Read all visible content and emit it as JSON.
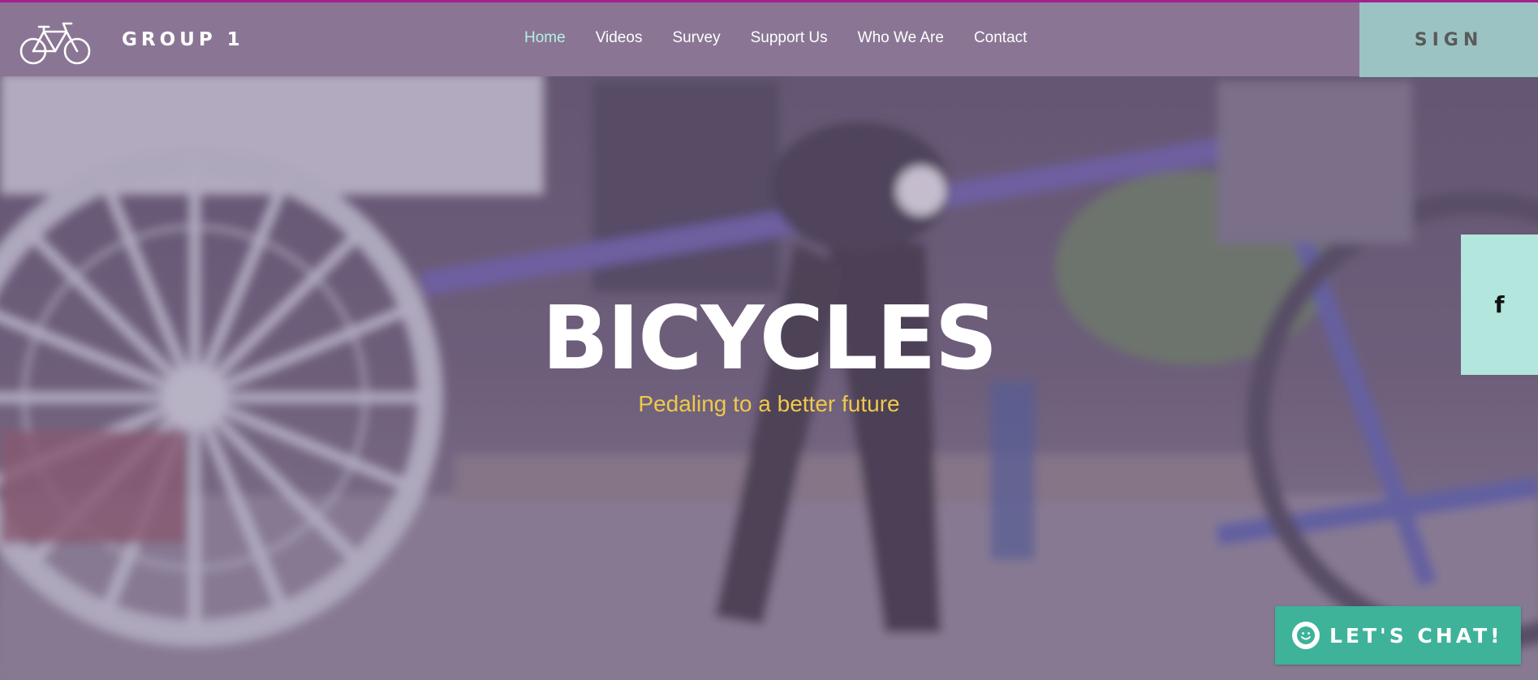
{
  "brand": {
    "name": "GROUP 1",
    "logo_icon": "bicycle-icon"
  },
  "nav": {
    "items": [
      {
        "label": "Home",
        "active": true
      },
      {
        "label": "Videos",
        "active": false
      },
      {
        "label": "Survey",
        "active": false
      },
      {
        "label": "Support Us",
        "active": false
      },
      {
        "label": "Who We Are",
        "active": false
      },
      {
        "label": "Contact",
        "active": false
      }
    ]
  },
  "header": {
    "sign_label": "SIGN"
  },
  "hero": {
    "title": "BICYCLES",
    "subtitle": "Pedaling to a better future"
  },
  "social": {
    "facebook_glyph": "f",
    "facebook_icon": "facebook-icon"
  },
  "chat": {
    "label": "LET'S CHAT!",
    "icon": "smile-icon"
  },
  "colors": {
    "header_bg": "#8a7694",
    "top_accent": "#a4218f",
    "sign_bg": "#9cc3c3",
    "active_nav": "#b8efe6",
    "subtitle": "#f0c84a",
    "facebook_tab": "#b3e6dc",
    "chat_bg": "#3fb29a"
  }
}
